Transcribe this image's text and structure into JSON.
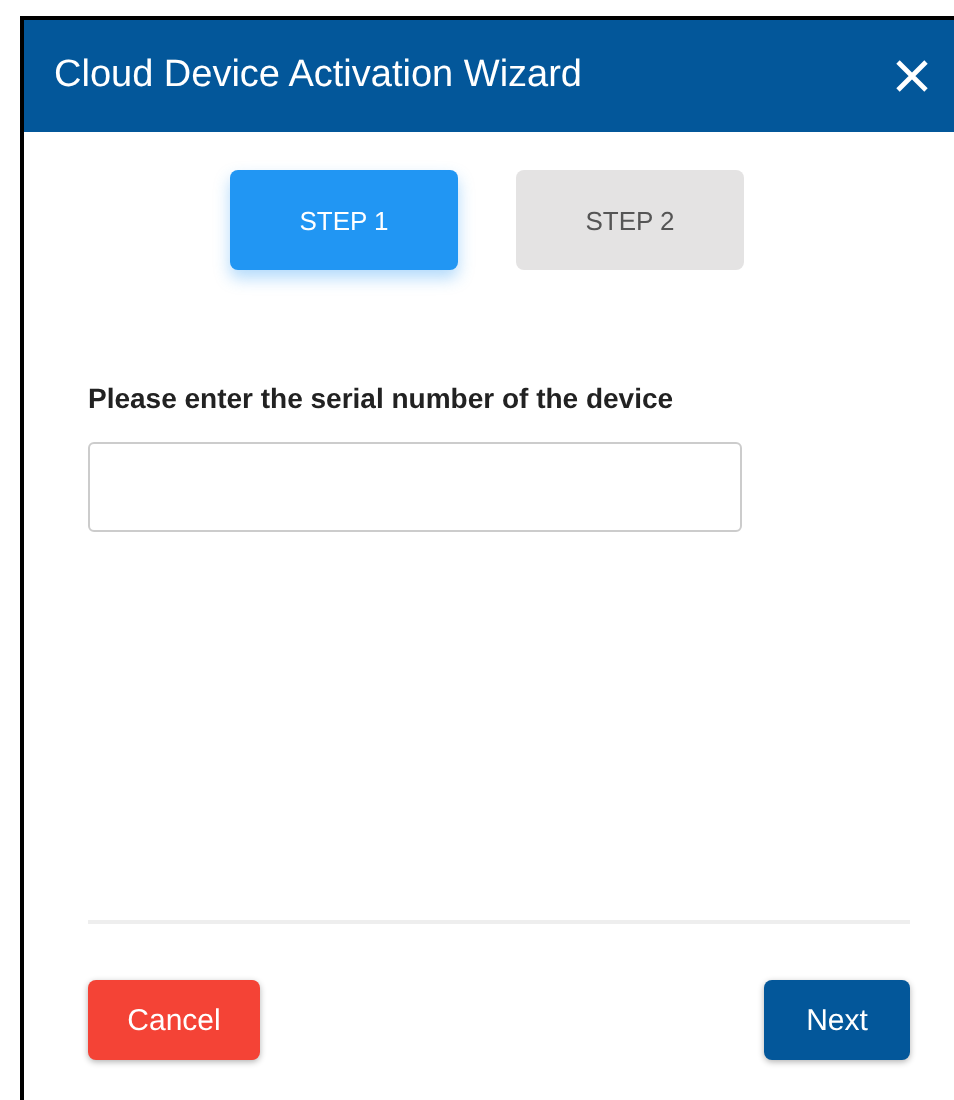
{
  "window": {
    "title": "Cloud Device Activation Wizard"
  },
  "steps": [
    {
      "label": "STEP 1",
      "selected": true
    },
    {
      "label": "STEP 2",
      "selected": false
    }
  ],
  "field": {
    "label": "Please enter the serial number of the device"
  },
  "buttons": {
    "cancel": "Cancel",
    "next": "Next"
  }
}
